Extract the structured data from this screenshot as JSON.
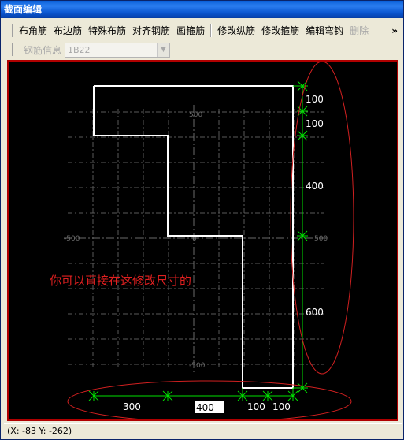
{
  "window": {
    "title": "截面编辑"
  },
  "toolbar": {
    "buttons": [
      "布角筋",
      "布边筋",
      "特殊布筋",
      "对齐钢筋",
      "画箍筋",
      "修改纵筋",
      "修改箍筋",
      "编辑弯钩",
      "删除"
    ],
    "more": "»"
  },
  "toolbar2": {
    "label": "钢筋信息",
    "combo_value": "1B22"
  },
  "canvas": {
    "axis_labels": {
      "top": "500",
      "left": "-500",
      "right": "500",
      "center": "0",
      "bottom": "-500"
    },
    "right_dims": [
      "100",
      "100",
      "400",
      "600"
    ],
    "bottom_dims": [
      "300",
      "100",
      "100"
    ],
    "bottom_input_value": "400",
    "annotation": "你可以直接在这修改尺寸的",
    "colors": {
      "background": "#000000",
      "outline": "#ffffff",
      "dimension": "#00ff00",
      "grid": "#606060",
      "annotation": "#e02020",
      "frame": "#b00000"
    }
  },
  "status": {
    "coords": "(X: -83 Y: -262)"
  }
}
